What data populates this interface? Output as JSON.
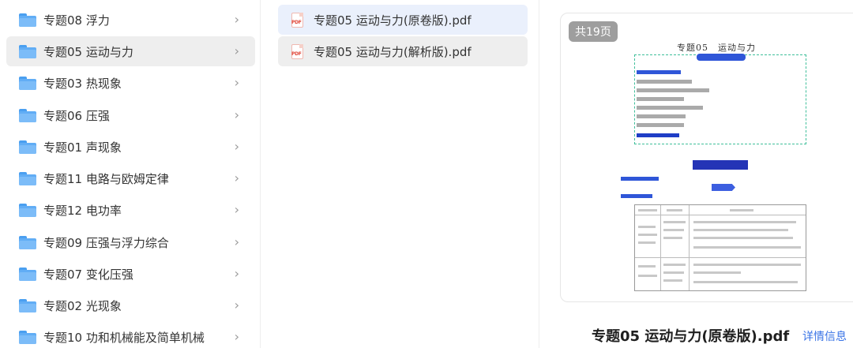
{
  "folders": [
    {
      "label": "专题08 浮力",
      "selected": false
    },
    {
      "label": "专题05 运动与力",
      "selected": true
    },
    {
      "label": "专题03 热现象",
      "selected": false
    },
    {
      "label": "专题06 压强",
      "selected": false
    },
    {
      "label": "专题01 声现象",
      "selected": false
    },
    {
      "label": "专题11 电路与欧姆定律",
      "selected": false
    },
    {
      "label": "专题12 电功率",
      "selected": false
    },
    {
      "label": "专题09 压强与浮力综合",
      "selected": false
    },
    {
      "label": "专题07 变化压强",
      "selected": false
    },
    {
      "label": "专题02 光现象",
      "selected": false
    },
    {
      "label": "专题10 功和机械能及简单机械",
      "selected": false
    }
  ],
  "files": [
    {
      "label": "专题05 运动与力(原卷版).pdf",
      "icon": "pdf-icon",
      "state": "active"
    },
    {
      "label": "专题05 运动与力(解析版).pdf",
      "icon": "pdf-icon",
      "state": "hover"
    }
  ],
  "preview": {
    "page_count": "共19页",
    "doc_title": "专题05　运动与力",
    "file_name": "专题05 运动与力(原卷版).pdf",
    "details_label": "详情信息"
  },
  "colors": {
    "selection_bg": "#eeeeee",
    "active_file_bg": "#eaf0fc",
    "link": "#3a74e6",
    "folder_icon": "#61adf5"
  }
}
